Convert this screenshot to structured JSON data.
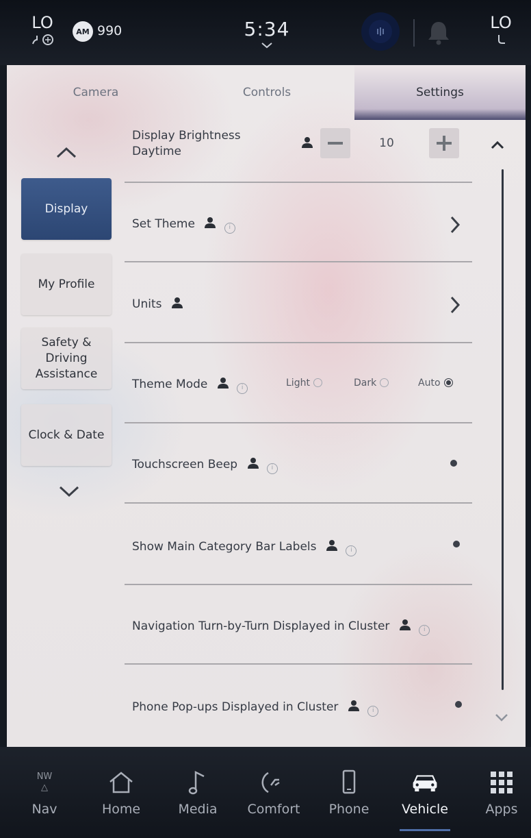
{
  "status_bar": {
    "left_climate": "LO",
    "right_climate": "LO",
    "radio_band": "AM",
    "radio_frequency": "990",
    "time": "5:34"
  },
  "tabs": [
    {
      "label": "Camera"
    },
    {
      "label": "Controls"
    },
    {
      "label": "Settings",
      "active": true
    }
  ],
  "categories": [
    {
      "label": "Display",
      "active": true
    },
    {
      "label": "My Profile"
    },
    {
      "label": "Safety & Driving Assistance"
    },
    {
      "label": "Clock & Date"
    }
  ],
  "settings": {
    "brightness": {
      "label_line1": "Display Brightness",
      "label_line2": "Daytime",
      "value": "10"
    },
    "set_theme": {
      "label": "Set Theme"
    },
    "units": {
      "label": "Units"
    },
    "theme_mode": {
      "label": "Theme Mode",
      "options": [
        "Light",
        "Dark",
        "Auto"
      ],
      "selected": "Auto"
    },
    "touchscreen_beep": {
      "label": "Touchscreen Beep"
    },
    "category_bar_labels": {
      "label": "Show Main Category Bar Labels"
    },
    "nav_turn_by_turn": {
      "label": "Navigation Turn-by-Turn Displayed in Cluster"
    },
    "phone_popups": {
      "label": "Phone Pop-ups Displayed in Cluster"
    }
  },
  "bottom_nav": {
    "compass_heading": "NW",
    "items": [
      {
        "label": "Nav",
        "icon": "compass-icon"
      },
      {
        "label": "Home",
        "icon": "home-icon"
      },
      {
        "label": "Media",
        "icon": "music-note-icon"
      },
      {
        "label": "Comfort",
        "icon": "seat-icon"
      },
      {
        "label": "Phone",
        "icon": "phone-icon"
      },
      {
        "label": "Vehicle",
        "icon": "vehicle-icon",
        "active": true
      },
      {
        "label": "Apps",
        "icon": "apps-grid-icon"
      }
    ]
  },
  "colors": {
    "active_category": "#34507f",
    "nav_active_underline": "#4f6ea8",
    "screen_background": "#ece8e9"
  }
}
